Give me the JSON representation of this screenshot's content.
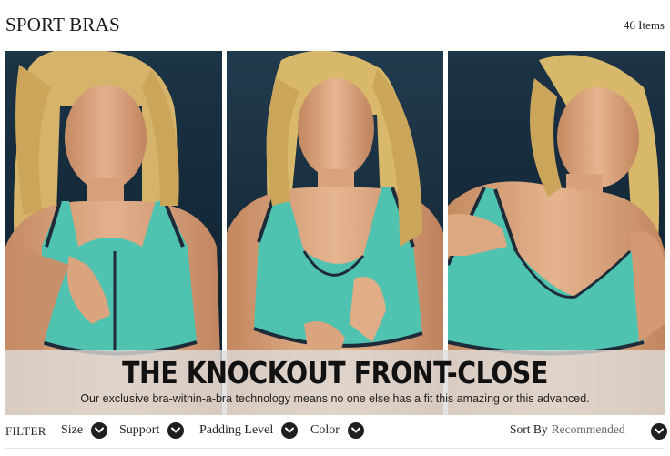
{
  "header": {
    "title": "SPORT BRAS",
    "item_count": "46 Items"
  },
  "hero": {
    "headline": "THE KNOCKOUT FRONT-CLOSE",
    "subline": "Our exclusive bra-within-a-bra technology means no one else has a fit this amazing or this advanced.",
    "colors": {
      "background": "#0f2333",
      "bra": "#4fc2b0",
      "trim": "#1e2c3a",
      "skin": "#d9a57f",
      "hair": "#d8b86a"
    }
  },
  "filters": {
    "label": "FILTER",
    "items": [
      {
        "label": "Size",
        "icon": "chevron-down-icon"
      },
      {
        "label": "Support",
        "icon": "chevron-down-icon"
      },
      {
        "label": "Padding Level",
        "icon": "chevron-down-icon"
      },
      {
        "label": "Color",
        "icon": "chevron-down-icon"
      }
    ],
    "sort": {
      "label": "Sort By",
      "value": "Recommended",
      "icon": "chevron-down-icon"
    }
  }
}
